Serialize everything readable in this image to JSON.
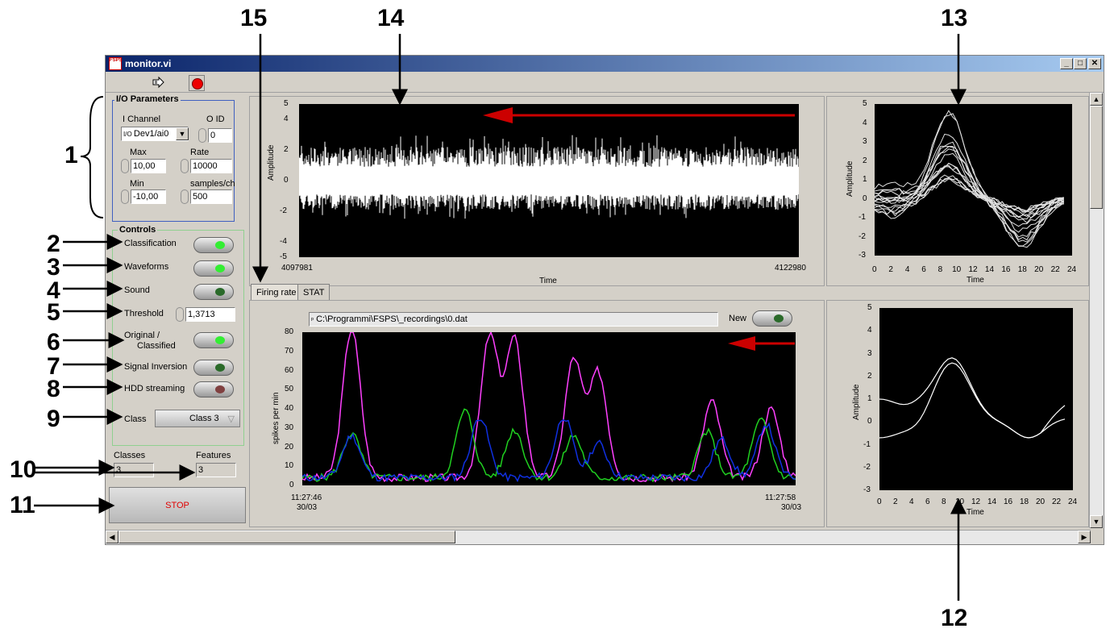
{
  "window": {
    "title": "monitor.vi",
    "app_icon": "FSPS"
  },
  "callouts": [
    "1",
    "2",
    "3",
    "4",
    "5",
    "6",
    "7",
    "8",
    "9",
    "10",
    "11",
    "12",
    "13",
    "14",
    "15"
  ],
  "io": {
    "group_title": "I/O Parameters",
    "channel_label": "I Channel",
    "channel_value": "Dev1/ai0",
    "id_label": "O  ID",
    "id_value": "0",
    "max_label": "Max",
    "max_value": "10,00",
    "rate_label": "Rate",
    "rate_value": "10000",
    "min_label": "Min",
    "min_value": "-10,00",
    "samples_label": "samples/ch",
    "samples_value": "500"
  },
  "controls": {
    "group_title": "Controls",
    "classification": "Classification",
    "waveforms": "Waveforms",
    "sound": "Sound",
    "threshold": "Threshold",
    "threshold_value": "1,3713",
    "orig1": "Original /",
    "orig2": "Classified",
    "inversion": "Signal Inversion",
    "hdd": "HDD streaming",
    "class_label": "Class",
    "class_value": "Class 3",
    "classes_label": "Classes",
    "classes_value": "3",
    "features_label": "Features",
    "features_value": "3",
    "stop": "STOP"
  },
  "raw": {
    "ylabel": "Amplitude",
    "xlabel": "Time",
    "x_start": "4097981",
    "x_end": "4122980",
    "yticks": [
      "5",
      "4",
      "2",
      "0",
      "-2",
      "-4",
      "-5"
    ]
  },
  "tabs": {
    "firing": "Firing rate",
    "stat": "STAT"
  },
  "firing": {
    "path": "C:\\Programmi\\FSPS\\_recordings\\0.dat",
    "new_label": "New",
    "ylabel": "spikes per min",
    "yticks": [
      "80",
      "70",
      "60",
      "50",
      "40",
      "30",
      "20",
      "10",
      "0"
    ],
    "x_start_time": "11:27:46",
    "x_start_date": "30/03",
    "x_end_time": "11:27:58",
    "x_end_date": "30/03"
  },
  "wave": {
    "ylabel": "Amplitude",
    "xlabel": "Time",
    "yticks": [
      "5",
      "4",
      "3",
      "2",
      "1",
      "0",
      "-1",
      "-2",
      "-3"
    ],
    "xticks": [
      "0",
      "2",
      "4",
      "6",
      "8",
      "10",
      "12",
      "14",
      "16",
      "18",
      "20",
      "22",
      "24"
    ]
  }
}
